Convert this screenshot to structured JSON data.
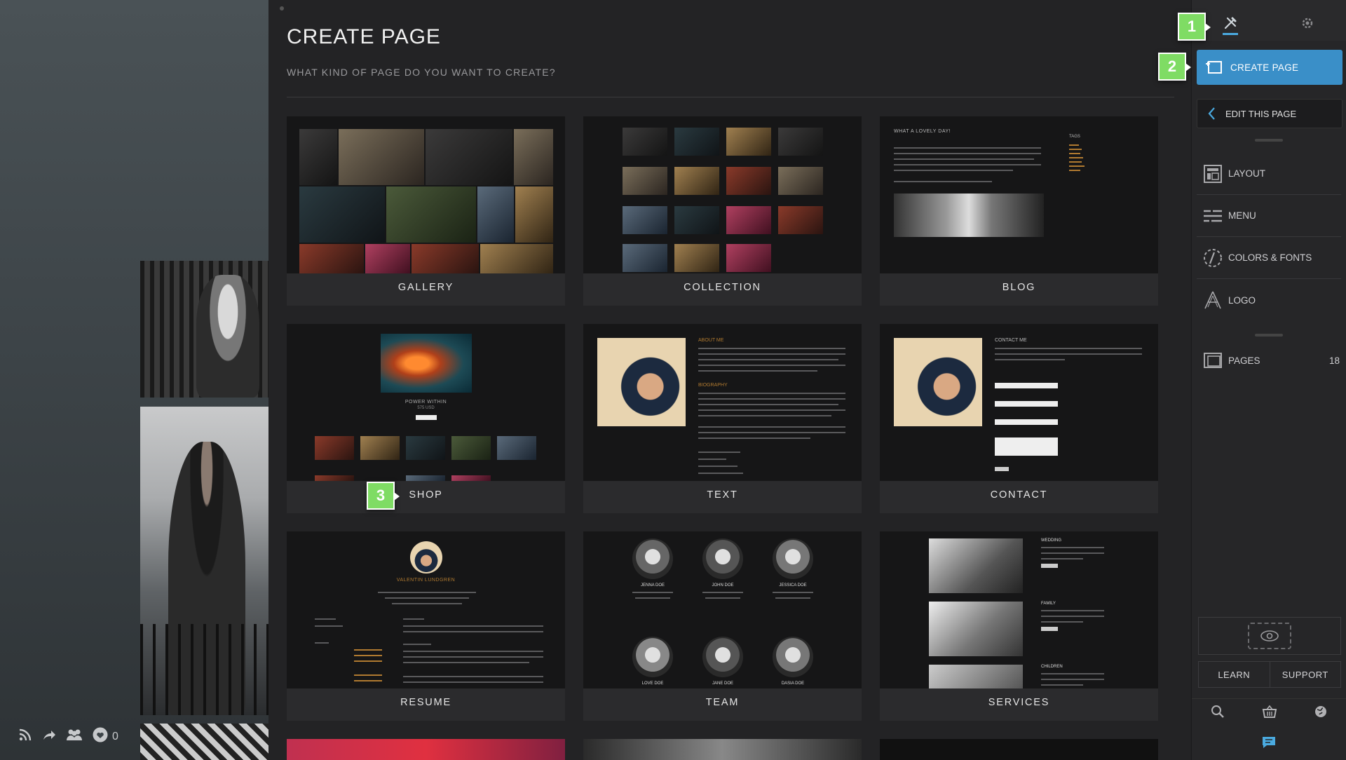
{
  "site": {
    "social": {
      "rss_icon": "rss-icon",
      "share_icon": "share-icon",
      "people_icon": "people-icon",
      "like_count": "0"
    }
  },
  "main": {
    "title": "CREATE PAGE",
    "subtitle": "WHAT KIND OF PAGE DO YOU WANT TO CREATE?",
    "page_types": [
      {
        "label": "GALLERY"
      },
      {
        "label": "COLLECTION"
      },
      {
        "label": "BLOG"
      },
      {
        "label": "SHOP"
      },
      {
        "label": "TEXT"
      },
      {
        "label": "CONTACT"
      },
      {
        "label": "RESUME"
      },
      {
        "label": "TEAM"
      },
      {
        "label": "SERVICES"
      }
    ],
    "thumb_text": {
      "blog_heading": "WHAT A LOVELY DAY!",
      "blog_tags": "TAGS",
      "shop_product": "POWER WITHIN",
      "shop_price": "575 USD",
      "text_about": "ABOUT ME",
      "text_bio": "BIOGRAPHY",
      "contact_heading": "CONTACT ME",
      "resume_name": "VALENTIN LUNDGREN",
      "team_names": [
        "JENNA DOE",
        "JOHN DOE",
        "JESSICA DOE",
        "LOVE DOE",
        "JANE DOE",
        "DASIA DOE"
      ],
      "services_items": [
        "WEDDING",
        "FAMILY",
        "CHILDREN"
      ]
    }
  },
  "sidebar": {
    "tab_tools_icon": "tools-icon",
    "tab_settings_icon": "gear-icon",
    "create_page_label": "CREATE PAGE",
    "edit_page_label": "EDIT THIS PAGE",
    "items": [
      {
        "label": "LAYOUT",
        "icon": "layout-icon"
      },
      {
        "label": "MENU",
        "icon": "menu-icon"
      },
      {
        "label": "COLORS & FONTS",
        "icon": "colors-fonts-icon"
      },
      {
        "label": "LOGO",
        "icon": "logo-icon"
      }
    ],
    "pages_label": "PAGES",
    "pages_count": "18",
    "learn_label": "LEARN",
    "support_label": "SUPPORT"
  },
  "badges": [
    "1",
    "2",
    "3"
  ],
  "colors": {
    "accent": "#3a8fc8",
    "badge": "#7fdc64",
    "panel": "#232325"
  }
}
